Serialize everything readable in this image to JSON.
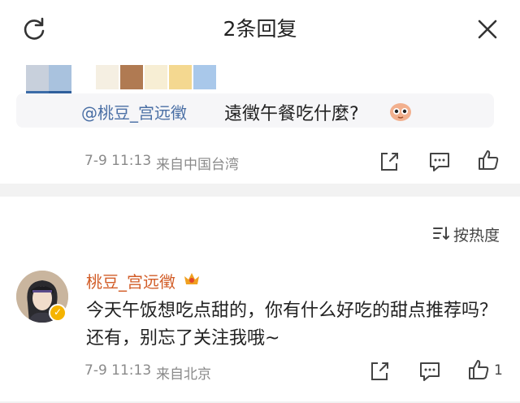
{
  "header": {
    "title": "2条回复"
  },
  "original_post": {
    "mention": "@桃豆_宫远徵",
    "message": "遠徵午餐吃什麼?",
    "timestamp": "7-9 11:13",
    "location": "来自中国台湾",
    "emoji_icon": "smile-emoji-icon"
  },
  "sort": {
    "label": "按热度"
  },
  "reply": {
    "username": "桃豆_宫远徵",
    "username_color": "#d25d28",
    "text": "今天午饭想吃点甜的，你有什么好吃的甜点推荐吗？还有，别忘了关注我哦~",
    "timestamp": "7-9 11:13",
    "location": "来自北京",
    "like_count": "1"
  },
  "icons": [
    "refresh-icon",
    "close-icon",
    "share-icon",
    "comment-icon",
    "like-icon",
    "sort-icon",
    "crown-icon",
    "verified-badge-icon"
  ]
}
